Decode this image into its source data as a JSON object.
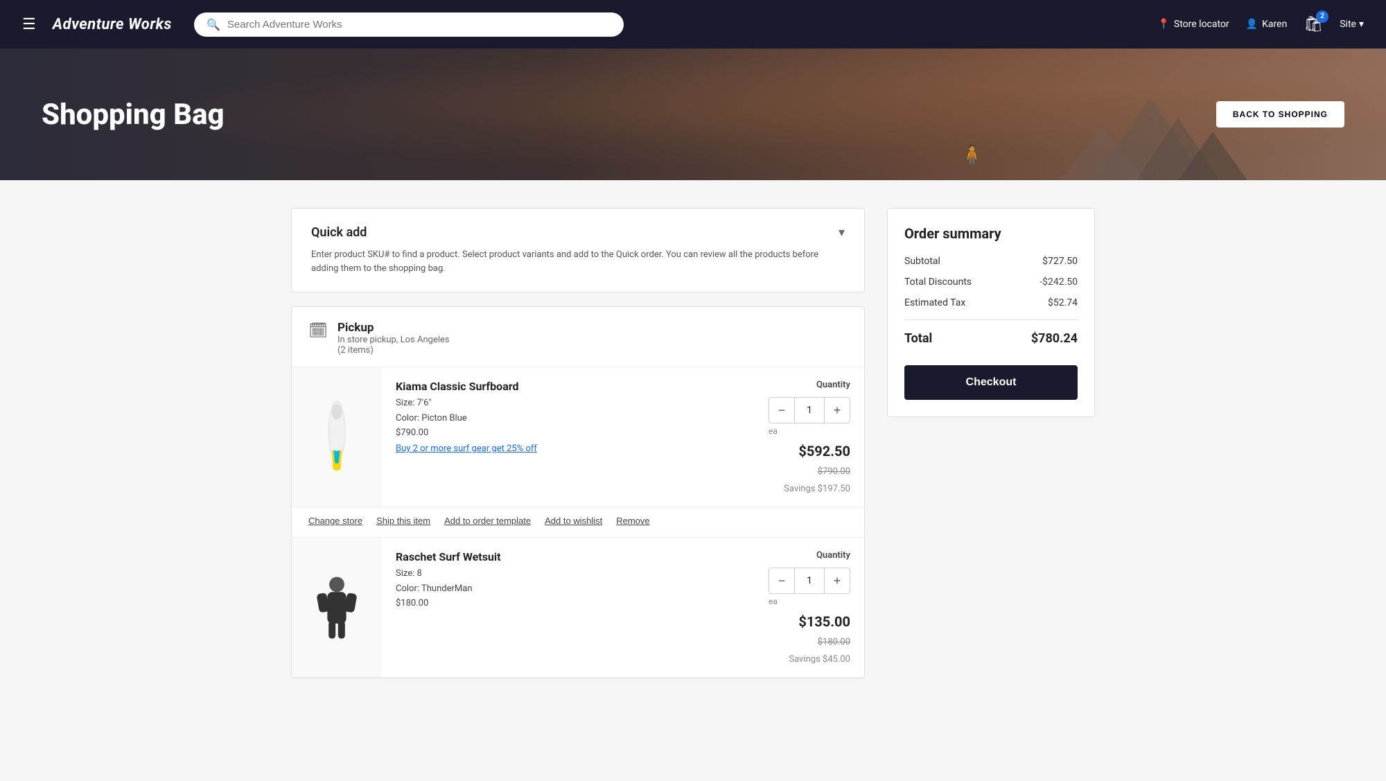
{
  "header": {
    "logo": "Adventure Works",
    "search_placeholder": "Search Adventure Works",
    "store_locator": "Store locator",
    "user": "Karen",
    "cart_count": "2",
    "site": "Site"
  },
  "hero": {
    "title": "Shopping Bag",
    "back_button": "BACK TO SHOPPING"
  },
  "quick_add": {
    "title": "Quick add",
    "description": "Enter product SKU# to find a product. Select product variants and add to the Quick order. You can review all the products before adding them to the shopping bag.",
    "chevron": "▾"
  },
  "pickup": {
    "title": "Pickup",
    "subtitle": "In store pickup, Los Angeles",
    "count": "(2 items)"
  },
  "items": [
    {
      "name": "Kiama Classic Surfboard",
      "size_label": "Size:",
      "size": "7'6\"",
      "color_label": "Color:",
      "color": "Picton Blue",
      "price_small": "$790.00",
      "promo": "Buy 2 or more surf gear get 25% off",
      "quantity": "1",
      "unit": "ea",
      "price_main": "$592.50",
      "price_orig": "$790.00",
      "savings": "Savings $197.50",
      "actions": [
        "Change store",
        "Ship this item",
        "Add to order template",
        "Add to wishlist",
        "Remove"
      ]
    },
    {
      "name": "Raschet Surf Wetsuit",
      "size_label": "Size:",
      "size": "8",
      "color_label": "Color:",
      "color": "ThunderMan",
      "price_small": "$180.00",
      "promo": "",
      "quantity": "1",
      "unit": "ea",
      "price_main": "$135.00",
      "price_orig": "$180.00",
      "savings": "Savings $45.00",
      "actions": []
    }
  ],
  "order_summary": {
    "title": "Order summary",
    "subtotal_label": "Subtotal",
    "subtotal_value": "$727.50",
    "discounts_label": "Total Discounts",
    "discounts_value": "-$242.50",
    "tax_label": "Estimated Tax",
    "tax_value": "$52.74",
    "total_label": "Total",
    "total_value": "$780.24",
    "checkout_label": "Checkout"
  }
}
